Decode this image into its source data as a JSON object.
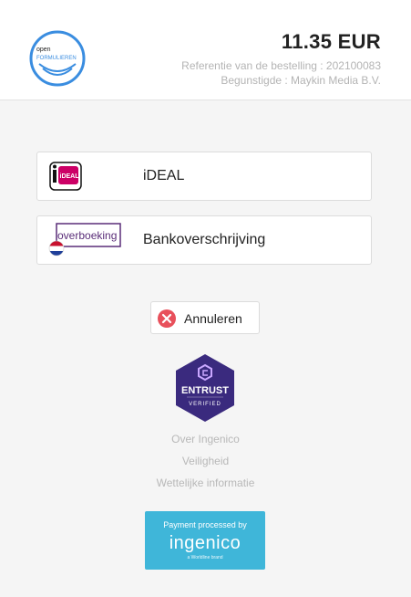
{
  "brand": {
    "logo_line1": "open",
    "logo_line2": "FORMULIEREN"
  },
  "order": {
    "amount": "11.35 EUR",
    "reference": "Referentie van de bestelling : 202100083",
    "beneficiary": "Begunstigde : Maykin Media B.V."
  },
  "payment_methods": [
    {
      "label": "iDEAL",
      "logo_text": "iDEAL",
      "icon": "ideal-logo-icon"
    },
    {
      "label": "Bankoverschrijving",
      "logo_text": "overboeking",
      "icon": "overboeking-logo-icon"
    }
  ],
  "cancel": {
    "label": "Annuleren",
    "icon": "close-icon",
    "color": "#e8505b"
  },
  "security_badge": {
    "name": "ENTRUST",
    "subtitle": "VERIFIED",
    "color": "#3a2a7e"
  },
  "footer_links": [
    "Over Ingenico",
    "Veiligheid",
    "Wettelijke informatie"
  ],
  "processor": {
    "caption": "Payment processed by",
    "name": "ingenico",
    "sub": "a Worldline brand",
    "color": "#3fb6d9"
  }
}
